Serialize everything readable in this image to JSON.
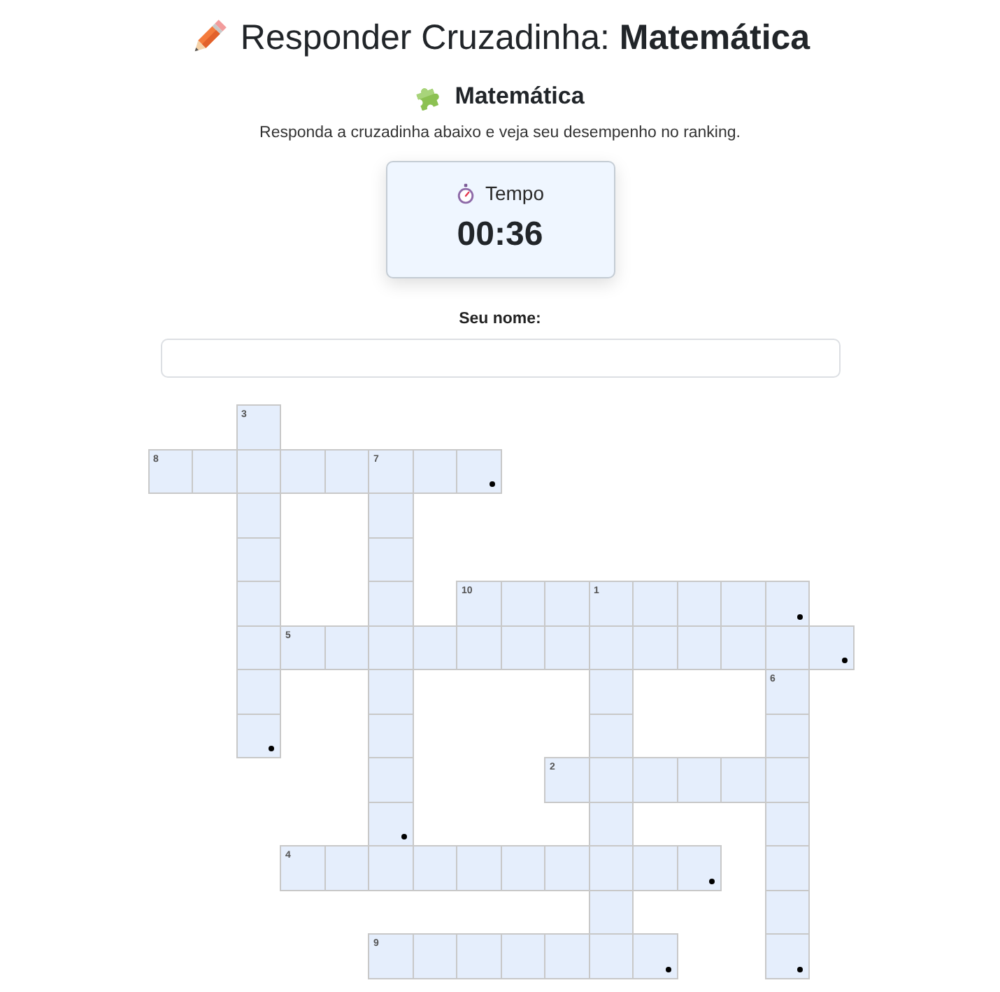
{
  "title": "Responder Cruzadinha: **Matemática**",
  "subtitle": "Matemática",
  "description": "Responda a cruzadinha abaixo e veja seu desempenho no ranking.",
  "timer": {
    "label": "Tempo",
    "value": "00:36"
  },
  "name_field": {
    "label": "Seu nome:"
  },
  "crossword": {
    "rows": [
      [
        {
          "kind": "gap"
        },
        {
          "kind": "gap"
        },
        {
          "kind": "letter",
          "number": "3",
          "marked": false
        },
        {
          "kind": "gap"
        },
        {
          "kind": "gap"
        },
        {
          "kind": "gap"
        },
        {
          "kind": "gap"
        },
        {
          "kind": "gap"
        },
        {
          "kind": "gap"
        },
        {
          "kind": "gap"
        },
        {
          "kind": "gap"
        },
        {
          "kind": "gap"
        },
        {
          "kind": "gap"
        },
        {
          "kind": "gap"
        },
        {
          "kind": "gap"
        },
        {
          "kind": "gap"
        }
      ],
      [
        {
          "kind": "letter",
          "number": "8",
          "marked": false
        },
        {
          "kind": "letter",
          "marked": false
        },
        {
          "kind": "letter",
          "marked": false
        },
        {
          "kind": "letter",
          "marked": false
        },
        {
          "kind": "letter",
          "marked": false
        },
        {
          "kind": "letter",
          "number": "7",
          "marked": false
        },
        {
          "kind": "letter",
          "marked": false
        },
        {
          "kind": "letter",
          "marked": true
        },
        {
          "kind": "gap"
        },
        {
          "kind": "gap"
        },
        {
          "kind": "gap"
        },
        {
          "kind": "gap"
        },
        {
          "kind": "gap"
        },
        {
          "kind": "gap"
        },
        {
          "kind": "gap"
        },
        {
          "kind": "gap"
        }
      ],
      [
        {
          "kind": "gap"
        },
        {
          "kind": "gap"
        },
        {
          "kind": "letter",
          "marked": false
        },
        {
          "kind": "gap"
        },
        {
          "kind": "gap"
        },
        {
          "kind": "letter",
          "marked": false
        },
        {
          "kind": "gap"
        },
        {
          "kind": "gap"
        },
        {
          "kind": "gap"
        },
        {
          "kind": "gap"
        },
        {
          "kind": "gap"
        },
        {
          "kind": "gap"
        },
        {
          "kind": "gap"
        },
        {
          "kind": "gap"
        },
        {
          "kind": "gap"
        },
        {
          "kind": "gap"
        }
      ],
      [
        {
          "kind": "gap"
        },
        {
          "kind": "gap"
        },
        {
          "kind": "letter",
          "marked": false
        },
        {
          "kind": "gap"
        },
        {
          "kind": "gap"
        },
        {
          "kind": "letter",
          "marked": false
        },
        {
          "kind": "gap"
        },
        {
          "kind": "gap"
        },
        {
          "kind": "gap"
        },
        {
          "kind": "gap"
        },
        {
          "kind": "gap"
        },
        {
          "kind": "gap"
        },
        {
          "kind": "gap"
        },
        {
          "kind": "gap"
        },
        {
          "kind": "gap"
        },
        {
          "kind": "gap"
        }
      ],
      [
        {
          "kind": "gap"
        },
        {
          "kind": "gap"
        },
        {
          "kind": "letter",
          "marked": false
        },
        {
          "kind": "gap"
        },
        {
          "kind": "gap"
        },
        {
          "kind": "letter",
          "marked": false
        },
        {
          "kind": "gap"
        },
        {
          "kind": "letter",
          "number": "10",
          "marked": false
        },
        {
          "kind": "letter",
          "marked": false
        },
        {
          "kind": "letter",
          "marked": false
        },
        {
          "kind": "letter",
          "number": "1",
          "marked": false
        },
        {
          "kind": "letter",
          "marked": false
        },
        {
          "kind": "letter",
          "marked": false
        },
        {
          "kind": "letter",
          "marked": false
        },
        {
          "kind": "letter",
          "marked": true
        },
        {
          "kind": "gap"
        }
      ],
      [
        {
          "kind": "gap"
        },
        {
          "kind": "gap"
        },
        {
          "kind": "letter",
          "marked": false
        },
        {
          "kind": "letter",
          "number": "5",
          "marked": false
        },
        {
          "kind": "letter",
          "marked": false
        },
        {
          "kind": "letter",
          "marked": false
        },
        {
          "kind": "letter",
          "marked": false
        },
        {
          "kind": "letter",
          "marked": false
        },
        {
          "kind": "letter",
          "marked": false
        },
        {
          "kind": "letter",
          "marked": false
        },
        {
          "kind": "letter",
          "marked": false
        },
        {
          "kind": "letter",
          "marked": false
        },
        {
          "kind": "letter",
          "marked": false
        },
        {
          "kind": "letter",
          "marked": false
        },
        {
          "kind": "letter",
          "marked": false
        },
        {
          "kind": "letter",
          "marked": true
        }
      ],
      [
        {
          "kind": "gap"
        },
        {
          "kind": "gap"
        },
        {
          "kind": "letter",
          "marked": false
        },
        {
          "kind": "gap"
        },
        {
          "kind": "gap"
        },
        {
          "kind": "letter",
          "marked": false
        },
        {
          "kind": "gap"
        },
        {
          "kind": "gap"
        },
        {
          "kind": "gap"
        },
        {
          "kind": "gap"
        },
        {
          "kind": "letter",
          "marked": false
        },
        {
          "kind": "gap"
        },
        {
          "kind": "gap"
        },
        {
          "kind": "gap"
        },
        {
          "kind": "letter",
          "number": "6",
          "marked": false
        },
        {
          "kind": "gap"
        }
      ],
      [
        {
          "kind": "gap"
        },
        {
          "kind": "gap"
        },
        {
          "kind": "letter",
          "marked": true
        },
        {
          "kind": "gap"
        },
        {
          "kind": "gap"
        },
        {
          "kind": "letter",
          "marked": false
        },
        {
          "kind": "gap"
        },
        {
          "kind": "gap"
        },
        {
          "kind": "gap"
        },
        {
          "kind": "gap"
        },
        {
          "kind": "letter",
          "marked": false
        },
        {
          "kind": "gap"
        },
        {
          "kind": "gap"
        },
        {
          "kind": "gap"
        },
        {
          "kind": "letter",
          "marked": false
        },
        {
          "kind": "gap"
        }
      ],
      [
        {
          "kind": "gap"
        },
        {
          "kind": "gap"
        },
        {
          "kind": "gap"
        },
        {
          "kind": "gap"
        },
        {
          "kind": "gap"
        },
        {
          "kind": "letter",
          "marked": false
        },
        {
          "kind": "gap"
        },
        {
          "kind": "gap"
        },
        {
          "kind": "gap"
        },
        {
          "kind": "letter",
          "number": "2",
          "marked": false
        },
        {
          "kind": "letter",
          "marked": false
        },
        {
          "kind": "letter",
          "marked": false
        },
        {
          "kind": "letter",
          "marked": false
        },
        {
          "kind": "letter",
          "marked": false
        },
        {
          "kind": "letter",
          "marked": false
        },
        {
          "kind": "gap"
        }
      ],
      [
        {
          "kind": "gap"
        },
        {
          "kind": "gap"
        },
        {
          "kind": "gap"
        },
        {
          "kind": "gap"
        },
        {
          "kind": "gap"
        },
        {
          "kind": "letter",
          "marked": true
        },
        {
          "kind": "gap"
        },
        {
          "kind": "gap"
        },
        {
          "kind": "gap"
        },
        {
          "kind": "gap"
        },
        {
          "kind": "letter",
          "marked": false
        },
        {
          "kind": "gap"
        },
        {
          "kind": "gap"
        },
        {
          "kind": "gap"
        },
        {
          "kind": "letter",
          "marked": false
        },
        {
          "kind": "gap"
        }
      ],
      [
        {
          "kind": "gap"
        },
        {
          "kind": "gap"
        },
        {
          "kind": "gap"
        },
        {
          "kind": "letter",
          "number": "4",
          "marked": false
        },
        {
          "kind": "letter",
          "marked": false
        },
        {
          "kind": "letter",
          "marked": false
        },
        {
          "kind": "letter",
          "marked": false
        },
        {
          "kind": "letter",
          "marked": false
        },
        {
          "kind": "letter",
          "marked": false
        },
        {
          "kind": "letter",
          "marked": false
        },
        {
          "kind": "letter",
          "marked": false
        },
        {
          "kind": "letter",
          "marked": false
        },
        {
          "kind": "letter",
          "marked": true
        },
        {
          "kind": "gap"
        },
        {
          "kind": "letter",
          "marked": false
        },
        {
          "kind": "gap"
        }
      ],
      [
        {
          "kind": "gap"
        },
        {
          "kind": "gap"
        },
        {
          "kind": "gap"
        },
        {
          "kind": "gap"
        },
        {
          "kind": "gap"
        },
        {
          "kind": "gap"
        },
        {
          "kind": "gap"
        },
        {
          "kind": "gap"
        },
        {
          "kind": "gap"
        },
        {
          "kind": "gap"
        },
        {
          "kind": "letter",
          "marked": false
        },
        {
          "kind": "gap"
        },
        {
          "kind": "gap"
        },
        {
          "kind": "gap"
        },
        {
          "kind": "letter",
          "marked": false
        },
        {
          "kind": "gap"
        }
      ],
      [
        {
          "kind": "gap"
        },
        {
          "kind": "gap"
        },
        {
          "kind": "gap"
        },
        {
          "kind": "gap"
        },
        {
          "kind": "gap"
        },
        {
          "kind": "letter",
          "number": "9",
          "marked": false
        },
        {
          "kind": "letter",
          "marked": false
        },
        {
          "kind": "letter",
          "marked": false
        },
        {
          "kind": "letter",
          "marked": false
        },
        {
          "kind": "letter",
          "marked": false
        },
        {
          "kind": "letter",
          "marked": false
        },
        {
          "kind": "letter",
          "marked": true
        },
        {
          "kind": "gap"
        },
        {
          "kind": "gap"
        },
        {
          "kind": "letter",
          "marked": true
        },
        {
          "kind": "gap"
        }
      ]
    ]
  }
}
